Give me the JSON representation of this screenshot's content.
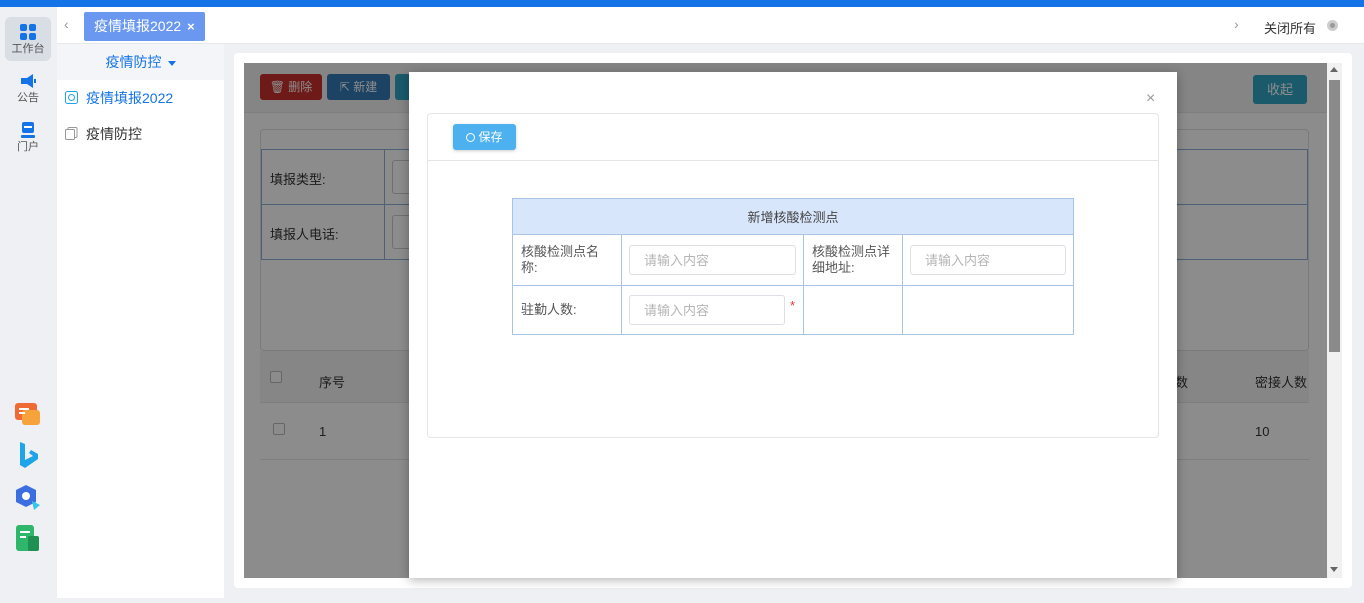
{
  "tabbar": {
    "tab_label": "疫情填报2022",
    "close_all": "关闭所有"
  },
  "rail": {
    "items": [
      {
        "label": "工作台",
        "icon": "grid-icon"
      },
      {
        "label": "公告",
        "icon": "megaphone-icon"
      },
      {
        "label": "门户",
        "icon": "portal-icon"
      }
    ]
  },
  "menu": {
    "header": "疫情防控",
    "items": [
      {
        "label": "疫情填报2022",
        "icon": "form-icon"
      },
      {
        "label": "疫情防控",
        "icon": "copy-icon"
      }
    ]
  },
  "toolbar": {
    "delete": "删除",
    "new": "新建",
    "collapse": "收起"
  },
  "search_form": {
    "fill_type": "填报类型:",
    "reporter_phone": "填报人电话:"
  },
  "table": {
    "columns": {
      "index": "序号",
      "col_partial": "数",
      "close_contacts": "密接人数"
    },
    "rows": [
      {
        "index": "1",
        "close_contacts": "10"
      }
    ]
  },
  "modal": {
    "save": "保存",
    "form_title": "新增核酸检测点",
    "fields": {
      "site_name_label": "核酸检测点名称:",
      "site_address_label": "核酸检测点详细地址:",
      "staff_count_label": "驻勤人数:",
      "placeholder": "请输入内容",
      "required_mark": "*"
    }
  },
  "colors": {
    "accent": "#1473e6",
    "tab_bg": "#6a98f0",
    "delete_btn": "#c9302c",
    "new_btn": "#337ab7",
    "collapse_btn": "#31a4c4",
    "save_btn": "#4db1f0"
  }
}
